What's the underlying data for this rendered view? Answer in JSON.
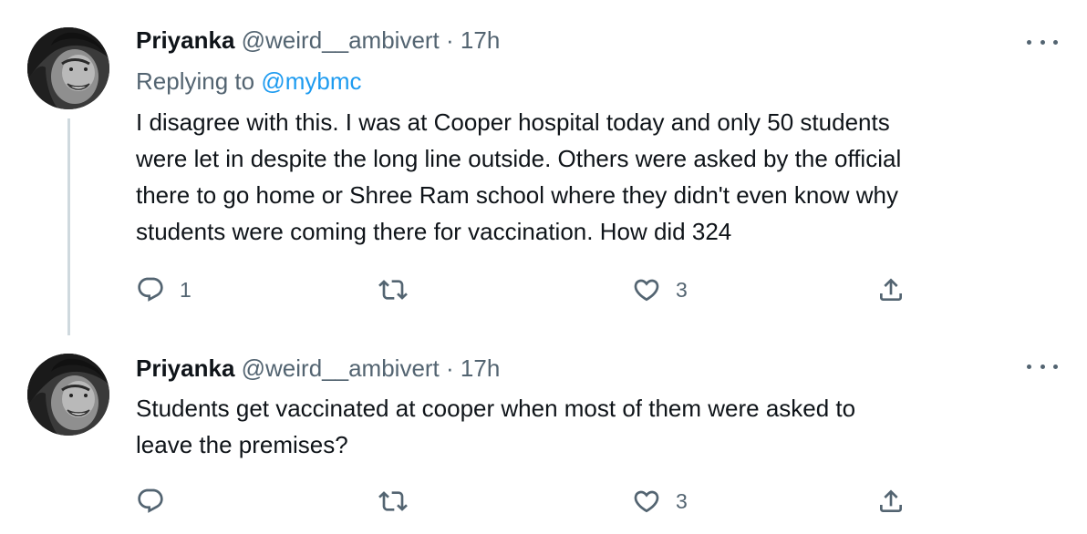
{
  "thread": {
    "tweets": [
      {
        "author_name": "Priyanka",
        "handle": "@weird__ambivert",
        "separator": "·",
        "time": "17h",
        "replying_prefix": "Replying to",
        "replying_to": "@mybmc",
        "text": "I disagree with this. I was at Cooper hospital today and only 50 students\nwere let in despite the long line outside. Others were asked by the official\nthere to go home or Shree Ram school where they didn't even know why\nstudents were coming there for vaccination. How did 324",
        "reply_count": "1",
        "retweet_count": "",
        "like_count": "3"
      },
      {
        "author_name": "Priyanka",
        "handle": "@weird__ambivert",
        "separator": "·",
        "time": "17h",
        "text": "Students get vaccinated at cooper when most of them were asked to\nleave the premises?",
        "reply_count": "",
        "retweet_count": "",
        "like_count": "3"
      }
    ]
  },
  "icons": {
    "reply": "reply-icon",
    "retweet": "retweet-icon",
    "like": "heart-icon",
    "share": "share-icon",
    "more": "more-options-icon"
  },
  "colors": {
    "text": "#0f1419",
    "secondary": "#536471",
    "link": "#1d9bf0",
    "thread_line": "#cfd9de"
  }
}
